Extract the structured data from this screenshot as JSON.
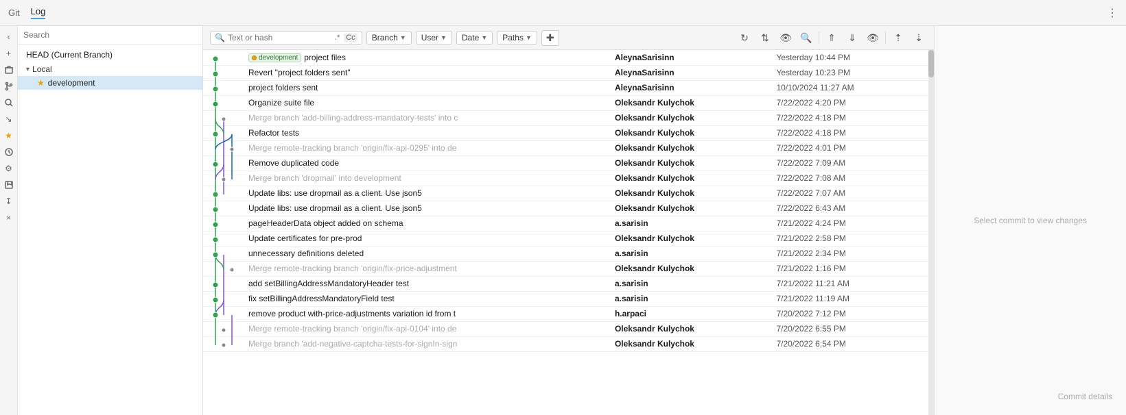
{
  "topbar": {
    "git_label": "Git",
    "log_label": "Log",
    "more_icon": "⋮"
  },
  "search": {
    "placeholder": "Text or hash",
    "regex_label": ".*",
    "cc_label": "Cc"
  },
  "toolbar": {
    "branch_label": "Branch",
    "user_label": "User",
    "date_label": "Date",
    "paths_label": "Paths",
    "new_branch_icon": "⊞"
  },
  "sidebar": {
    "search_placeholder": "Search",
    "head_label": "HEAD (Current Branch)",
    "local_label": "Local",
    "branches": [
      {
        "name": "development",
        "active": true
      }
    ]
  },
  "right_panel": {
    "select_text": "Select commit to view changes",
    "commit_details": "Commit details"
  },
  "commits": [
    {
      "message": "project files",
      "branch_tag": "development",
      "author": "AleynaSarisinn",
      "date": "Yesterday 10:44 PM",
      "dimmed": false,
      "selected": false
    },
    {
      "message": "Revert \"project folders sent\"",
      "branch_tag": null,
      "author": "AleynaSarisinn",
      "date": "Yesterday 10:23 PM",
      "dimmed": false,
      "selected": false
    },
    {
      "message": "project folders sent",
      "branch_tag": null,
      "author": "AleynaSarisinn",
      "date": "10/10/2024 11:27 AM",
      "dimmed": false,
      "selected": false
    },
    {
      "message": "Organize suite file",
      "branch_tag": null,
      "author": "Oleksandr Kulychok",
      "date": "7/22/2022 4:20 PM",
      "dimmed": false,
      "selected": false
    },
    {
      "message": "Merge branch 'add-billing-address-mandatory-tests' into c",
      "branch_tag": null,
      "author": "Oleksandr Kulychok",
      "date": "7/22/2022 4:18 PM",
      "dimmed": true,
      "selected": false
    },
    {
      "message": "Refactor tests",
      "branch_tag": null,
      "author": "Oleksandr Kulychok",
      "date": "7/22/2022 4:18 PM",
      "dimmed": false,
      "selected": false
    },
    {
      "message": "Merge remote-tracking branch 'origin/fix-api-0295' into de",
      "branch_tag": null,
      "author": "Oleksandr Kulychok",
      "date": "7/22/2022 4:01 PM",
      "dimmed": true,
      "selected": false
    },
    {
      "message": "Remove duplicated code",
      "branch_tag": null,
      "author": "Oleksandr Kulychok",
      "date": "7/22/2022 7:09 AM",
      "dimmed": false,
      "selected": false
    },
    {
      "message": "Merge branch 'dropmail' into development",
      "branch_tag": null,
      "author": "Oleksandr Kulychok",
      "date": "7/22/2022 7:08 AM",
      "dimmed": true,
      "selected": false
    },
    {
      "message": "Update libs: use dropmail as a client. Use json5",
      "branch_tag": null,
      "author": "Oleksandr Kulychok",
      "date": "7/22/2022 7:07 AM",
      "dimmed": false,
      "selected": false
    },
    {
      "message": "Update libs: use dropmail as a client. Use json5",
      "branch_tag": null,
      "author": "Oleksandr Kulychok",
      "date": "7/22/2022 6:43 AM",
      "dimmed": false,
      "selected": false
    },
    {
      "message": "pageHeaderData object added on schema",
      "branch_tag": null,
      "author": "a.sarisin",
      "date": "7/21/2022 4:24 PM",
      "dimmed": false,
      "selected": false
    },
    {
      "message": "Update certificates for pre-prod",
      "branch_tag": null,
      "author": "Oleksandr Kulychok",
      "date": "7/21/2022 2:58 PM",
      "dimmed": false,
      "selected": false
    },
    {
      "message": "unnecessary definitions deleted",
      "branch_tag": null,
      "author": "a.sarisin",
      "date": "7/21/2022 2:34 PM",
      "dimmed": false,
      "selected": false
    },
    {
      "message": "Merge remote-tracking branch 'origin/fix-price-adjustment",
      "branch_tag": null,
      "author": "Oleksandr Kulychok",
      "date": "7/21/2022 1:16 PM",
      "dimmed": true,
      "selected": false
    },
    {
      "message": "add setBillingAddressMandatoryHeader test",
      "branch_tag": null,
      "author": "a.sarisin",
      "date": "7/21/2022 11:21 AM",
      "dimmed": false,
      "selected": false
    },
    {
      "message": "fix setBillingAddressMandatoryField test",
      "branch_tag": null,
      "author": "a.sarisin",
      "date": "7/21/2022 11:19 AM",
      "dimmed": false,
      "selected": false
    },
    {
      "message": "remove product with-price-adjustments variation id from t",
      "branch_tag": null,
      "author": "h.arpaci",
      "date": "7/20/2022 7:12 PM",
      "dimmed": false,
      "selected": false
    },
    {
      "message": "Merge remote-tracking branch 'origin/fix-api-0104' into de",
      "branch_tag": null,
      "author": "Oleksandr Kulychok",
      "date": "7/20/2022 6:55 PM",
      "dimmed": true,
      "selected": false
    },
    {
      "message": "Merge branch 'add-negative-captcha-tests-for-signIn-sign",
      "branch_tag": null,
      "author": "Oleksandr Kulychok",
      "date": "7/20/2022 6:54 PM",
      "dimmed": true,
      "selected": false
    }
  ]
}
